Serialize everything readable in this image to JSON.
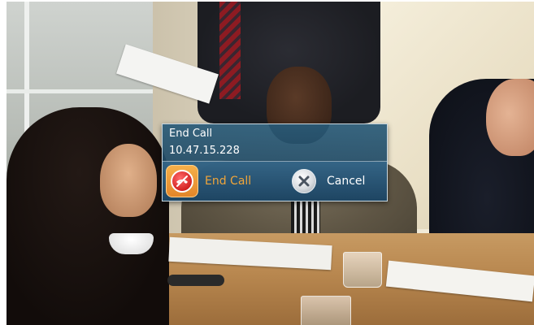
{
  "dialog": {
    "title": "End Call",
    "address": "10.47.15.228",
    "buttons": {
      "end_call": {
        "label": "End Call",
        "icon": "hang-up-icon",
        "highlighted": true
      },
      "cancel": {
        "label": "Cancel",
        "icon": "close-icon"
      }
    }
  },
  "colors": {
    "dialog_bg": "#285a78",
    "end_call_accent": "#f0a53a",
    "end_call_icon_red": "#d32222",
    "text": "#ffffff"
  }
}
